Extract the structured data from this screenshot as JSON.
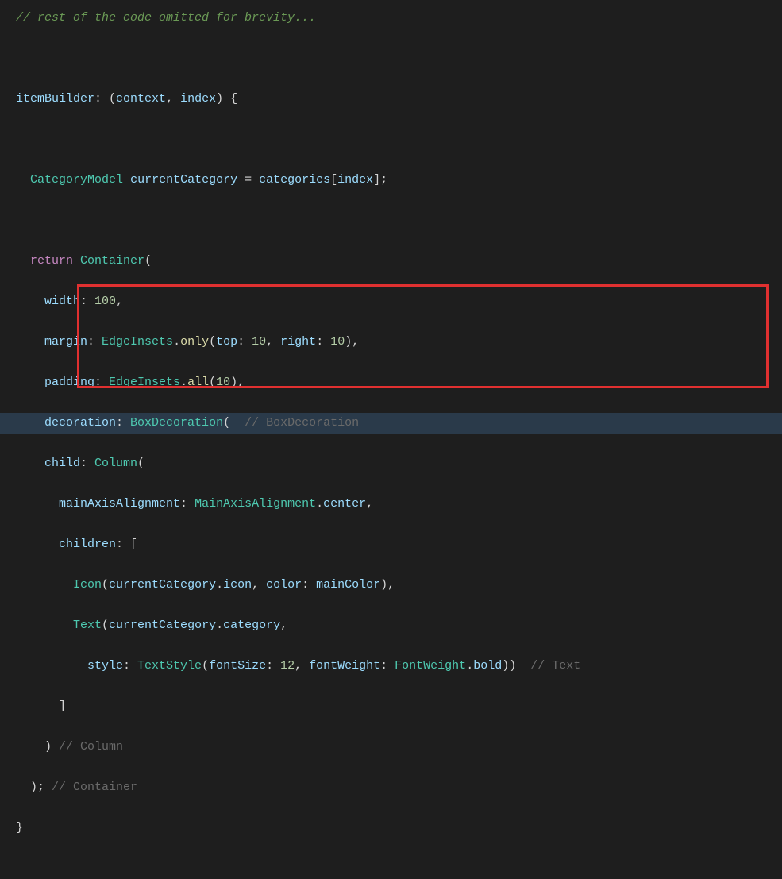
{
  "code": {
    "line1_comment": "// rest of the code omitted for brevity...",
    "line3_itemBuilder": "itemBuilder",
    "line3_context": "context",
    "line3_index": "index",
    "line5_CategoryModel": "CategoryModel",
    "line5_currentCategory": "currentCategory",
    "line5_categories": "categories",
    "line5_indexVar": "index",
    "line7_return": "return",
    "line7_Container": "Container",
    "line8_width": "width",
    "line8_width_val": "100",
    "line9_margin": "margin",
    "line9_EdgeInsets": "EdgeInsets",
    "line9_only": "only",
    "line9_top": "top",
    "line9_top_val": "10",
    "line9_right": "right",
    "line9_right_val": "10",
    "line10_padding": "padding",
    "line10_EdgeInsets": "EdgeInsets",
    "line10_all": "all",
    "line10_all_val": "10",
    "line11_decoration": "decoration",
    "line11_BoxDecoration": "BoxDecoration",
    "line11_hint": "// BoxDecoration",
    "line12_child": "child",
    "line12_Column": "Column",
    "line13_mainAxisAlignment": "mainAxisAlignment",
    "line13_MainAxisAlignment": "MainAxisAlignment",
    "line13_center": "center",
    "line14_children": "children",
    "line15_Icon": "Icon",
    "line15_currentCategory": "currentCategory",
    "line15_icon": "icon",
    "line15_color": "color",
    "line15_mainColor": "mainColor",
    "line16_Text": "Text",
    "line16_currentCategory": "currentCategory",
    "line16_category": "category",
    "line17_style": "style",
    "line17_TextStyle": "TextStyle",
    "line17_fontSize": "fontSize",
    "line17_fontSize_val": "12",
    "line17_fontWeight": "fontWeight",
    "line17_FontWeight": "FontWeight",
    "line17_bold": "bold",
    "line17_hint": "// Text",
    "line19_hint": "// Column",
    "line20_hint": "// Container"
  }
}
